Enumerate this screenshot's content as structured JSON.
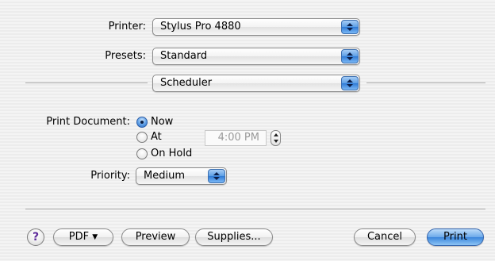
{
  "printer": {
    "label": "Printer:",
    "value": "Stylus Pro 4880"
  },
  "presets": {
    "label": "Presets:",
    "value": "Standard"
  },
  "panel": {
    "value": "Scheduler"
  },
  "print_document": {
    "label": "Print Document:",
    "options": [
      "Now",
      "At",
      "On Hold"
    ],
    "selected": "Now",
    "time_value": "4:00 PM"
  },
  "priority": {
    "label": "Priority:",
    "value": "Medium"
  },
  "buttons": {
    "help": "?",
    "pdf": "PDF",
    "pdf_arrow": "▼",
    "preview": "Preview",
    "supplies": "Supplies...",
    "cancel": "Cancel",
    "print": "Print"
  }
}
